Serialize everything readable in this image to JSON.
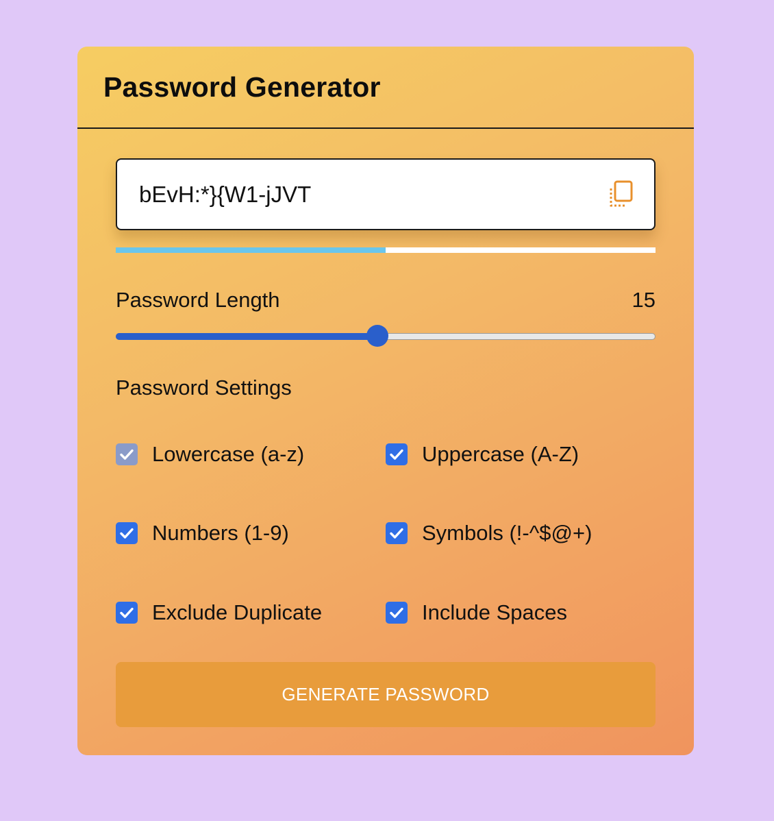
{
  "header": {
    "title": "Password Generator"
  },
  "password": {
    "value": "bEvH:*}{W1-jJVT",
    "copy_icon": "copy-icon"
  },
  "strength": {
    "level_fraction": 0.5,
    "color": "#6ac6ec"
  },
  "length": {
    "label": "Password Length",
    "value": "15",
    "slider_fraction": 0.485
  },
  "settings": {
    "label": "Password Settings",
    "options": [
      {
        "label": "Lowercase (a-z)",
        "checked": true,
        "disabled": true
      },
      {
        "label": "Uppercase (A-Z)",
        "checked": true,
        "disabled": false
      },
      {
        "label": "Numbers (1-9)",
        "checked": true,
        "disabled": false
      },
      {
        "label": "Symbols (!-^$@+)",
        "checked": true,
        "disabled": false
      },
      {
        "label": "Exclude Duplicate",
        "checked": true,
        "disabled": false
      },
      {
        "label": "Include Spaces",
        "checked": true,
        "disabled": false
      }
    ]
  },
  "generate": {
    "label": "GENERATE PASSWORD"
  },
  "colors": {
    "background": "#e0c8f8",
    "accent": "#2f6ee6",
    "button": "#e89c3c"
  }
}
